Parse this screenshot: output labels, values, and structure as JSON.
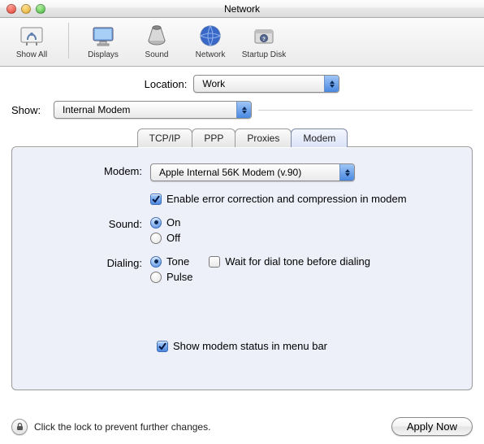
{
  "window": {
    "title": "Network"
  },
  "toolbar": {
    "items": [
      {
        "label": "Show All"
      },
      {
        "label": "Displays"
      },
      {
        "label": "Sound"
      },
      {
        "label": "Network"
      },
      {
        "label": "Startup Disk"
      }
    ]
  },
  "location": {
    "label": "Location:",
    "value": "Work"
  },
  "show": {
    "label": "Show:",
    "value": "Internal Modem"
  },
  "tabs": [
    {
      "label": "TCP/IP"
    },
    {
      "label": "PPP"
    },
    {
      "label": "Proxies"
    },
    {
      "label": "Modem"
    }
  ],
  "modem_panel": {
    "modem_label": "Modem:",
    "modem_value": "Apple Internal 56K Modem (v.90)",
    "enable_ec_label": "Enable error correction and compression in modem",
    "enable_ec_checked": true,
    "sound_label": "Sound:",
    "sound_on": "On",
    "sound_off": "Off",
    "sound_value": "On",
    "dialing_label": "Dialing:",
    "dialing_tone": "Tone",
    "dialing_pulse": "Pulse",
    "dialing_value": "Tone",
    "wait_dial_label": "Wait for dial tone before dialing",
    "wait_dial_checked": false,
    "show_status_label": "Show modem status in menu bar",
    "show_status_checked": true
  },
  "footer": {
    "lock_text": "Click the lock to prevent further changes.",
    "apply_label": "Apply Now"
  }
}
